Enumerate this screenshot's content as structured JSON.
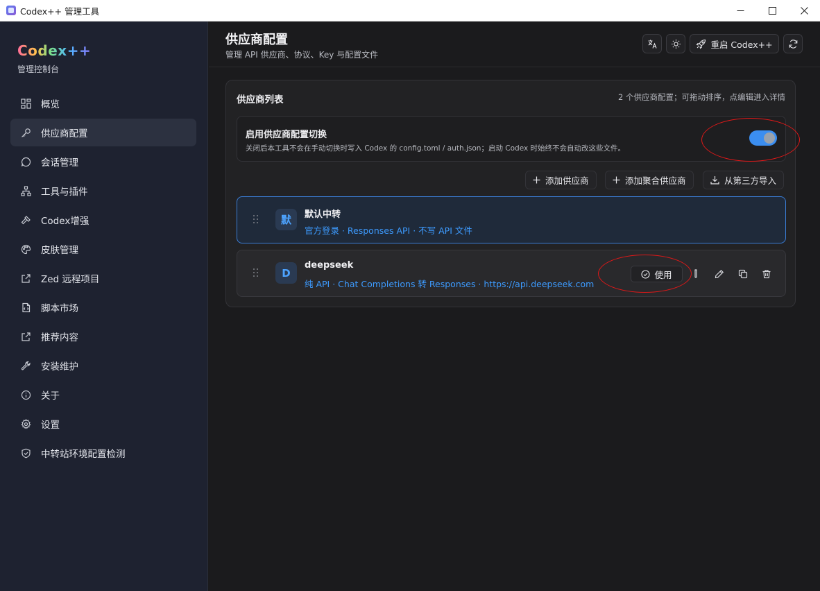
{
  "window": {
    "title": "Codex++ 管理工具"
  },
  "sidebar": {
    "brand": "Codex++",
    "subtitle": "管理控制台",
    "items": [
      {
        "label": "概览",
        "icon": "dashboard-icon"
      },
      {
        "label": "供应商配置",
        "icon": "key-icon",
        "active": true
      },
      {
        "label": "会话管理",
        "icon": "chat-icon"
      },
      {
        "label": "工具与插件",
        "icon": "network-icon"
      },
      {
        "label": "Codex增强",
        "icon": "hammer-icon"
      },
      {
        "label": "皮肤管理",
        "icon": "palette-icon"
      },
      {
        "label": "Zed 远程项目",
        "icon": "external-link-icon"
      },
      {
        "label": "脚本市场",
        "icon": "script-icon"
      },
      {
        "label": "推荐内容",
        "icon": "external-link-icon"
      },
      {
        "label": "安装维护",
        "icon": "wrench-icon"
      },
      {
        "label": "关于",
        "icon": "info-icon"
      },
      {
        "label": "设置",
        "icon": "gear-icon"
      },
      {
        "label": "中转站环境配置检测",
        "icon": "shield-icon"
      }
    ]
  },
  "header": {
    "title": "供应商配置",
    "subtitle": "管理 API 供应商、协议、Key 与配置文件",
    "restart_label": "重启 Codex++"
  },
  "card": {
    "title": "供应商列表",
    "note": "2 个供应商配置；可拖动排序，点编辑进入详情",
    "toggle": {
      "title": "启用供应商配置切换",
      "description": "关闭后本工具不会在手动切换时写入 Codex 的 config.toml / auth.json；启动 Codex 时始终不会自动改这些文件。",
      "enabled": true
    },
    "actions": {
      "add_provider": "添加供应商",
      "add_aggregate": "添加聚合供应商",
      "import": "从第三方导入"
    },
    "providers": [
      {
        "avatar": "默",
        "name": "默认中转",
        "description": "官方登录 · Responses API · 不写 API 文件",
        "selected": true
      },
      {
        "avatar": "D",
        "name": "deepseek",
        "description": "纯 API · Chat Completions 转 Responses · https://api.deepseek.com",
        "use_label": "使用"
      }
    ]
  },
  "colors": {
    "accent": "#3b8ef0",
    "link": "#3d9bff",
    "annotation": "#e01818"
  }
}
